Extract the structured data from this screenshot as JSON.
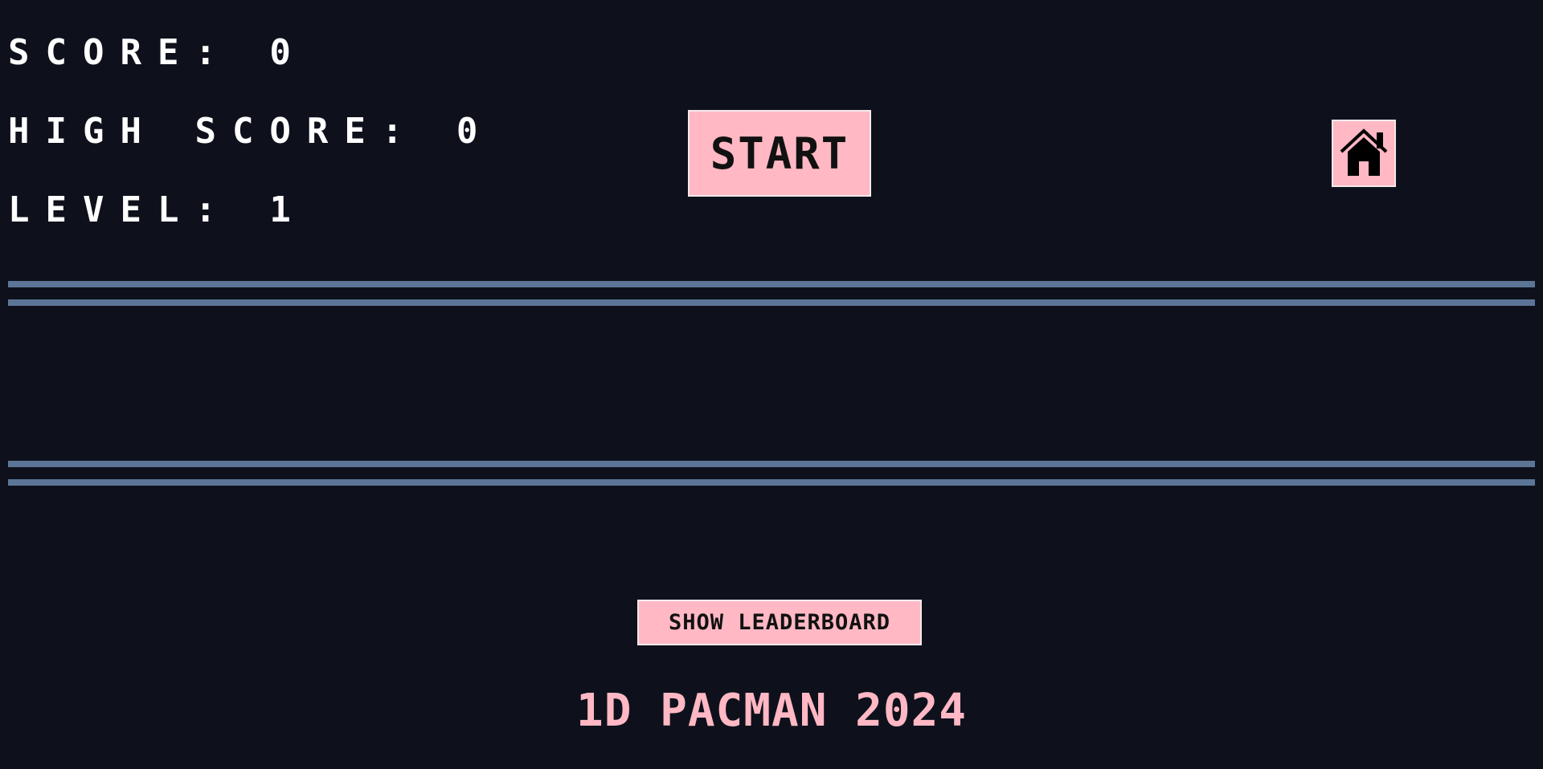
{
  "stats": {
    "score": "SCORE: 0",
    "high_score": "HIGH SCORE: 0",
    "level": "LEVEL: 1"
  },
  "controls": {
    "start_label": "START",
    "home_icon": "home-icon",
    "leaderboard_label": "SHOW LEADERBOARD"
  },
  "footer": {
    "title": "1D PACMAN 2024"
  },
  "colors": {
    "background": "#0e111c",
    "accent_pink": "#ffb8c4",
    "track_lines": "#5c7597",
    "text": "#ffffff"
  }
}
